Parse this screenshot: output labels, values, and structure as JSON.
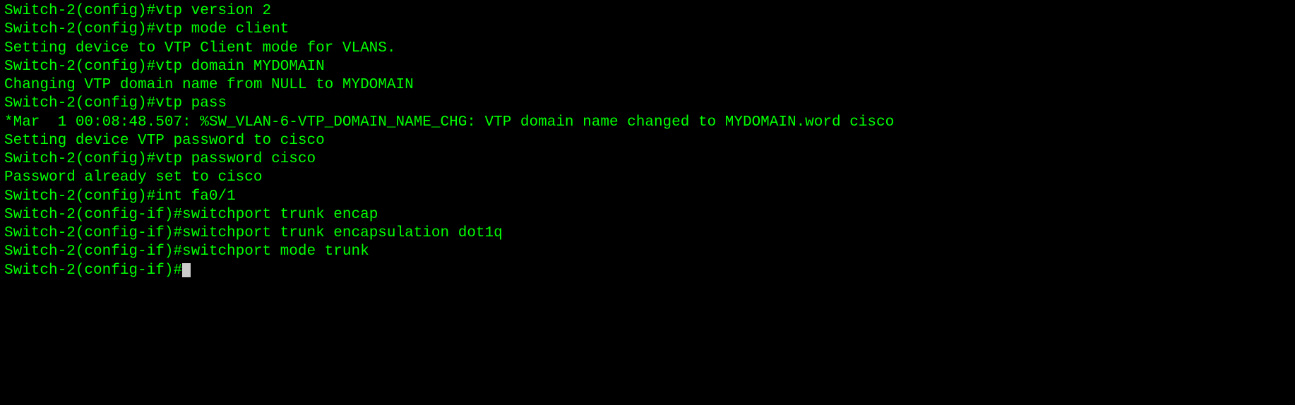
{
  "terminal": {
    "lines": [
      {
        "prompt": "Switch-2(config)#",
        "command": "vtp version 2"
      },
      {
        "prompt": "Switch-2(config)#",
        "command": "vtp mode client"
      },
      {
        "output": "Setting device to VTP Client mode for VLANS."
      },
      {
        "prompt": "Switch-2(config)#",
        "command": "vtp domain MYDOMAIN"
      },
      {
        "output": "Changing VTP domain name from NULL to MYDOMAIN"
      },
      {
        "prompt": "Switch-2(config)#",
        "command": "vtp pass"
      },
      {
        "output": "*Mar  1 00:08:48.507: %SW_VLAN-6-VTP_DOMAIN_NAME_CHG: VTP domain name changed to MYDOMAIN.word cisco"
      },
      {
        "output": "Setting device VTP password to cisco"
      },
      {
        "prompt": "Switch-2(config)#",
        "command": "vtp password cisco"
      },
      {
        "output": "Password already set to cisco"
      },
      {
        "prompt": "Switch-2(config)#",
        "command": "int fa0/1"
      },
      {
        "prompt": "Switch-2(config-if)#",
        "command": "switchport trunk encap"
      },
      {
        "prompt": "Switch-2(config-if)#",
        "command": "switchport trunk encapsulation dot1q"
      },
      {
        "prompt": "Switch-2(config-if)#",
        "command": "switchport mode trunk"
      },
      {
        "prompt": "Switch-2(config-if)#",
        "command": "",
        "cursor": true
      }
    ]
  }
}
